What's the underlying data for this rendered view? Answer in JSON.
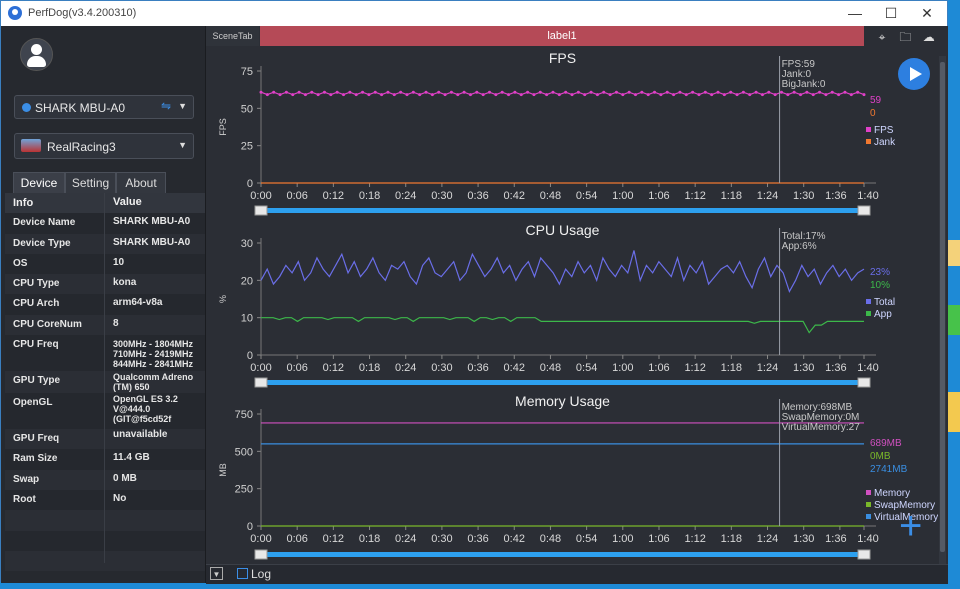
{
  "window": {
    "title": "PerfDog(v3.4.200310)",
    "minimize": "—",
    "maximize": "☐",
    "close": "✕"
  },
  "sidebar": {
    "device_select": "SHARK MBU-A0",
    "app_select": "RealRacing3",
    "tabs": [
      "Device",
      "Setting",
      "About"
    ],
    "table_header": {
      "key": "Info",
      "value": "Value"
    },
    "rows": [
      {
        "key": "Device Name",
        "value": "SHARK MBU-A0"
      },
      {
        "key": "Device Type",
        "value": "SHARK MBU-A0"
      },
      {
        "key": "OS",
        "value": "10"
      },
      {
        "key": "CPU Type",
        "value": "kona"
      },
      {
        "key": "CPU Arch",
        "value": "arm64-v8a"
      },
      {
        "key": "CPU CoreNum",
        "value": "8"
      },
      {
        "key": "CPU Freq",
        "value": "300MHz - 1804MHz\n710MHz - 2419MHz\n844MHz - 2841MHz"
      },
      {
        "key": "GPU Type",
        "value": "Qualcomm Adreno (TM) 650"
      },
      {
        "key": "OpenGL",
        "value": "OpenGL ES 3.2 V@444.0 (GIT@f5cd52f"
      },
      {
        "key": "GPU Freq",
        "value": "unavailable"
      },
      {
        "key": "Ram Size",
        "value": "11.4 GB"
      },
      {
        "key": "Swap",
        "value": "0 MB"
      },
      {
        "key": "Root",
        "value": "No"
      }
    ]
  },
  "main": {
    "scene_tab": "SceneTab",
    "label": "label1",
    "bottom_log": "Log"
  },
  "x_ticks": [
    "0:00",
    "0:06",
    "0:12",
    "0:18",
    "0:24",
    "0:30",
    "0:36",
    "0:42",
    "0:48",
    "0:54",
    "1:00",
    "1:06",
    "1:12",
    "1:18",
    "1:24",
    "1:30",
    "1:36",
    "1:40"
  ],
  "colors": {
    "accent": "#2d7fe0",
    "label_bar": "#b54a57",
    "fps": "#e040c8",
    "jank": "#f07830",
    "total": "#6a6ee8",
    "app": "#3cb84a",
    "memory": "#d050c0",
    "swap": "#7ab82a",
    "virtual": "#3a8ee0"
  },
  "chart_data": [
    {
      "type": "line",
      "title": "FPS",
      "ylabel": "FPS",
      "ylim": [
        0,
        75
      ],
      "yticks": [
        0,
        25,
        50,
        75
      ],
      "x": [
        "0:00",
        "1:40"
      ],
      "series": [
        {
          "name": "FPS",
          "current": "59",
          "value_approx": 60
        },
        {
          "name": "Jank",
          "current": "0",
          "value_approx": 0
        }
      ],
      "cursor_labels": [
        "FPS:59",
        "Jank:0",
        "BigJank:0"
      ]
    },
    {
      "type": "line",
      "title": "CPU Usage",
      "ylabel": "%",
      "ylim": [
        0,
        30
      ],
      "yticks": [
        0,
        10,
        20,
        30
      ],
      "series": [
        {
          "name": "Total",
          "current": "23%",
          "values": [
            20,
            23,
            19,
            21,
            24,
            22,
            25,
            20,
            22,
            26,
            23,
            21,
            24,
            27,
            22,
            25,
            21,
            23,
            26,
            22,
            20,
            24,
            23,
            25,
            21,
            19,
            24,
            26,
            22,
            21,
            23,
            25,
            20,
            22,
            27,
            24,
            21,
            23,
            26,
            22,
            24,
            20,
            23,
            25,
            21,
            26,
            24,
            22,
            19,
            23,
            21,
            25,
            22,
            24,
            20,
            26,
            23,
            21,
            24,
            22,
            28,
            20,
            24,
            22,
            25,
            23,
            21,
            26,
            20,
            24,
            22,
            25,
            19,
            21,
            23,
            24,
            22,
            25,
            21,
            18,
            23,
            26,
            21,
            24,
            22,
            17,
            20,
            24,
            21,
            23,
            19,
            22,
            24,
            21,
            23,
            20,
            22,
            23
          ]
        },
        {
          "name": "App",
          "current": "10%",
          "values": [
            10,
            10,
            10,
            9.5,
            10,
            10,
            9,
            10,
            10,
            10,
            10,
            9.5,
            10,
            10,
            10,
            10,
            9,
            10,
            10,
            10,
            10,
            10,
            9.5,
            10,
            10,
            9,
            10,
            10,
            10,
            10,
            10,
            9.5,
            10,
            10,
            10,
            9,
            10,
            10,
            9.5,
            10,
            10,
            9,
            10,
            10,
            10,
            10,
            9,
            9,
            9,
            9,
            9,
            9,
            9,
            9,
            9,
            9,
            9,
            9,
            9,
            9,
            9,
            9,
            9,
            9,
            9,
            9,
            9,
            9,
            9,
            9,
            9,
            9,
            9,
            9,
            9,
            9,
            9,
            9,
            9,
            9,
            9,
            8.5,
            9,
            9,
            9,
            9,
            9,
            9,
            9,
            9,
            6,
            8,
            8,
            9,
            9,
            9,
            9,
            9,
            9,
            9
          ]
        }
      ],
      "cursor_labels": [
        "Total:17%",
        "App:6%"
      ]
    },
    {
      "type": "line",
      "title": "Memory Usage",
      "ylabel": "MB",
      "ylim": [
        0,
        750
      ],
      "yticks": [
        0,
        250,
        500,
        750
      ],
      "series": [
        {
          "name": "Memory",
          "current": "689MB",
          "value_approx": 690
        },
        {
          "name": "SwapMemory",
          "current": "0MB",
          "value_approx": 0
        },
        {
          "name": "VirtualMemory",
          "current": "2741MB",
          "value_approx": 550
        }
      ],
      "cursor_labels": [
        "Memory:698MB",
        "SwapMemory:0M",
        "VirtualMemory:27"
      ]
    }
  ]
}
